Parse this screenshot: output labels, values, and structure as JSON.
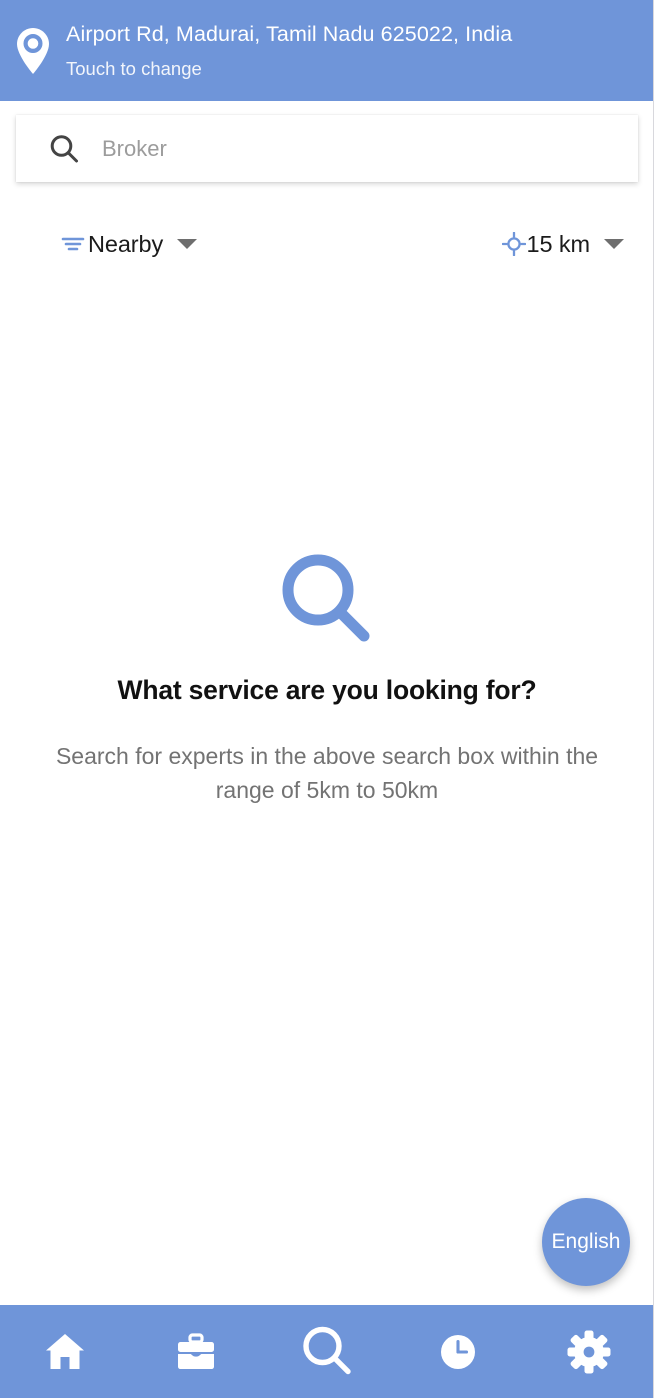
{
  "theme": {
    "brand_blue": "#6f95d9",
    "header_text": "#ffffff",
    "placeholder_gray": "#9c9c9c",
    "body_gray": "#737373",
    "title_black": "#111111"
  },
  "header": {
    "pin_icon": "location-pin-icon",
    "address": "Airport Rd, Madurai, Tamil Nadu 625022, India",
    "change_hint": "Touch to change"
  },
  "search": {
    "icon": "search-icon",
    "value": "",
    "placeholder": "Broker"
  },
  "filters": {
    "sort": {
      "icon": "filter-lines-icon",
      "label": "Nearby",
      "caret": "chevron-down-icon"
    },
    "radius": {
      "icon": "gps-crosshair-icon",
      "label": "15 km",
      "caret": "chevron-down-icon"
    }
  },
  "empty_state": {
    "icon": "magnifier-icon",
    "title": "What service are you looking for?",
    "subtitle": "Search for experts in the above search box within the range of 5km to 50km"
  },
  "language_fab": {
    "label": "English"
  },
  "bottom_nav": {
    "items": [
      {
        "name": "home",
        "icon": "home-icon",
        "active": false
      },
      {
        "name": "jobs",
        "icon": "briefcase-icon",
        "active": false
      },
      {
        "name": "search",
        "icon": "search-icon",
        "active": true
      },
      {
        "name": "history",
        "icon": "clock-icon",
        "active": false
      },
      {
        "name": "settings",
        "icon": "gear-icon",
        "active": false
      }
    ]
  }
}
